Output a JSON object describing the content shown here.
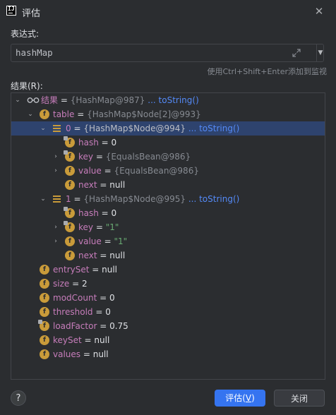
{
  "window": {
    "title": "评估",
    "logo_text": "IJ"
  },
  "expression": {
    "label": "表达式:",
    "value": "hashMap",
    "hint": "使用Ctrl+Shift+Enter添加到监视"
  },
  "results_label": "结果(R):",
  "tree": {
    "root": {
      "name": "结果",
      "eq": " = ",
      "ref": "{HashMap@987}",
      "link": "... toString()"
    },
    "table": {
      "name": "table",
      "eq": " = ",
      "ref": "{HashMap$Node[2]@993}"
    },
    "node0": {
      "name": "0",
      "eq": " = ",
      "ref": "{HashMap$Node@994}",
      "link": "... toString()"
    },
    "node0_hash": {
      "name": "hash",
      "eq": " = ",
      "val": "0"
    },
    "node0_key": {
      "name": "key",
      "eq": " = ",
      "ref": "{EqualsBean@986}"
    },
    "node0_value": {
      "name": "value",
      "eq": " = ",
      "ref": "{EqualsBean@986}"
    },
    "node0_next": {
      "name": "next",
      "eq": " = ",
      "val": "null"
    },
    "node1": {
      "name": "1",
      "eq": " = ",
      "ref": "{HashMap$Node@995}",
      "link": "... toString()"
    },
    "node1_hash": {
      "name": "hash",
      "eq": " = ",
      "val": "0"
    },
    "node1_key": {
      "name": "key",
      "eq": " = ",
      "str": "\"1\""
    },
    "node1_value": {
      "name": "value",
      "eq": " = ",
      "str": "\"1\""
    },
    "node1_next": {
      "name": "next",
      "eq": " = ",
      "val": "null"
    },
    "entrySet": {
      "name": "entrySet",
      "eq": " = ",
      "val": "null"
    },
    "size": {
      "name": "size",
      "eq": " = ",
      "val": "2"
    },
    "modCount": {
      "name": "modCount",
      "eq": " = ",
      "val": "0"
    },
    "threshold": {
      "name": "threshold",
      "eq": " = ",
      "val": "0"
    },
    "loadFactor": {
      "name": "loadFactor",
      "eq": " = ",
      "val": "0.75"
    },
    "keySet": {
      "name": "keySet",
      "eq": " = ",
      "val": "null"
    },
    "values": {
      "name": "values",
      "eq": " = ",
      "val": "null"
    }
  },
  "buttons": {
    "help": "?",
    "evaluate_main": "评估(",
    "evaluate_key": "V",
    "evaluate_end": ")",
    "close": "关闭"
  },
  "colors": {
    "accent": "#3574f0",
    "selection": "#2e436e",
    "field_icon": "#c99b3a"
  }
}
